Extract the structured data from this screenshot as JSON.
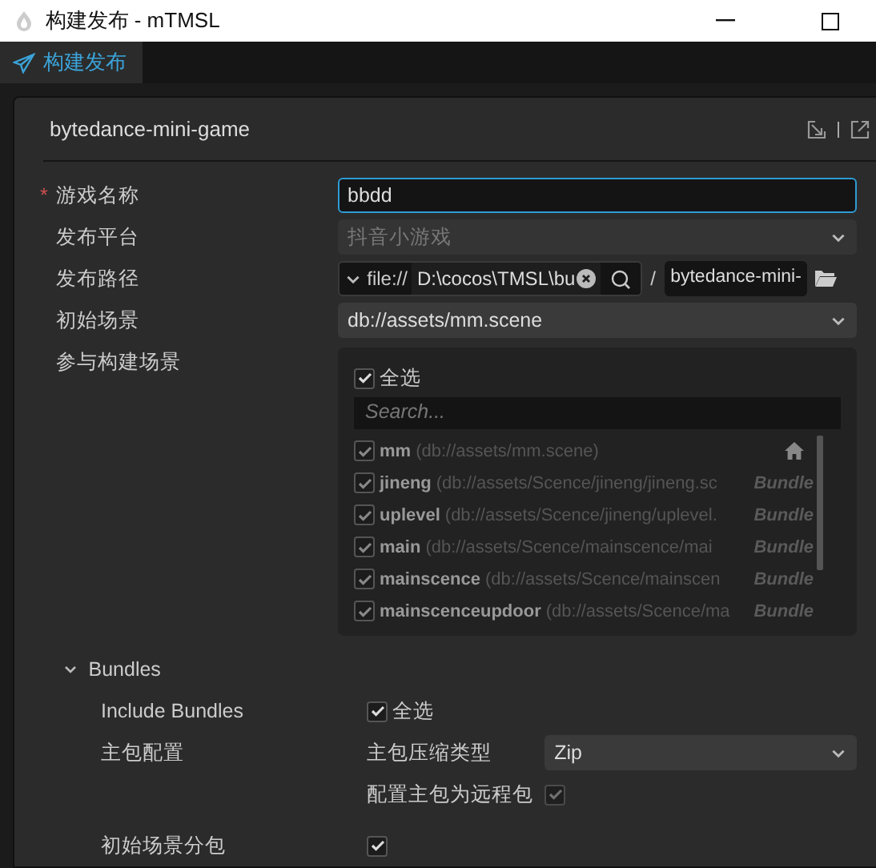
{
  "window": {
    "title": "构建发布 - mTMSL"
  },
  "tabs": [
    {
      "label": "构建发布",
      "selected": true
    }
  ],
  "panel": {
    "title": "bytedance-mini-game"
  },
  "fields": [
    {
      "kind": "text",
      "label": "游戏名称",
      "required_mark": "*",
      "value": "bbdd",
      "focused": true
    },
    {
      "kind": "select",
      "label": "发布平台",
      "value": "抖音小游戏",
      "disabled": true
    },
    {
      "kind": "path",
      "label": "发布路径",
      "protocol": "file://",
      "path": "D:\\cocos\\TMSL\\bu",
      "separator": "/",
      "name": "bytedance-mini-"
    },
    {
      "kind": "select",
      "label": "初始场景",
      "value": "db://assets/mm.scene",
      "disabled": false
    },
    {
      "kind": "scenes",
      "label": "参与构建场景",
      "select_all": {
        "label": "全选",
        "checked": true
      },
      "placeholder": "Search...",
      "items": [
        {
          "name": "mm",
          "path": "(db://assets/mm.scene)",
          "start": true,
          "checked": true
        },
        {
          "name": "jineng",
          "path": "(db://assets/Scence/jineng/jineng.sc",
          "tag": "Bundle",
          "start": false,
          "checked": true
        },
        {
          "name": "uplevel",
          "path": "(db://assets/Scence/jineng/uplevel.",
          "tag": "Bundle",
          "start": false,
          "checked": true
        },
        {
          "name": "main",
          "path": "(db://assets/Scence/mainscence/mai",
          "tag": "Bundle",
          "start": false,
          "checked": true
        },
        {
          "name": "mainscence",
          "path": "(db://assets/Scence/mainscen",
          "tag": "Bundle",
          "start": false,
          "checked": true
        },
        {
          "name": "mainscenceupdoor",
          "path": "(db://assets/Scence/ma",
          "tag": "Bundle",
          "start": false,
          "checked": true
        }
      ]
    }
  ],
  "bundles": {
    "title": "Bundles",
    "expanded": true,
    "include": {
      "label": "Include Bundles",
      "check_label": "全选",
      "checked": true
    },
    "main_pack": {
      "label": "主包配置",
      "compression_label": "主包压缩类型",
      "compression": "Zip",
      "remote_label": "配置主包为远程包",
      "remote": true,
      "remote_disabled": true
    },
    "start_scene_subpack": {
      "label": "初始场景分包",
      "checked": true
    }
  }
}
